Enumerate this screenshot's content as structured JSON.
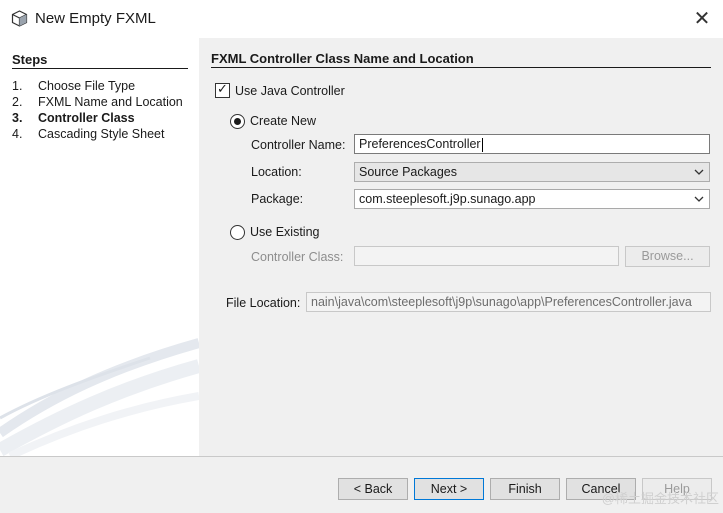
{
  "window": {
    "title": "New Empty FXML",
    "close_symbol": "✕"
  },
  "steps": {
    "title": "Steps",
    "items": [
      {
        "num": "1.",
        "label": "Choose File Type"
      },
      {
        "num": "2.",
        "label": "FXML Name and Location"
      },
      {
        "num": "3.",
        "label": "Controller Class"
      },
      {
        "num": "4.",
        "label": "Cascading Style Sheet"
      }
    ],
    "active_index": 2
  },
  "panel": {
    "title": "FXML Controller Class Name and Location",
    "use_java_controller": {
      "label": "Use Java Controller",
      "checked": true
    },
    "create_new": {
      "label": "Create New",
      "selected": true,
      "controller_name_label": "Controller Name:",
      "controller_name_value": "PreferencesController",
      "location_label": "Location:",
      "location_value": "Source Packages",
      "package_label": "Package:",
      "package_value": "com.steeplesoft.j9p.sunago.app"
    },
    "use_existing": {
      "label": "Use Existing",
      "selected": false,
      "controller_class_label": "Controller Class:",
      "controller_class_value": "",
      "browse_label": "Browse..."
    },
    "file_location": {
      "label": "File Location:",
      "value": "nain\\java\\com\\steeplesoft\\j9p\\sunago\\app\\PreferencesController.java"
    }
  },
  "buttons": {
    "back": "< Back",
    "next": "Next >",
    "finish": "Finish",
    "cancel": "Cancel",
    "help": "Help"
  },
  "watermark": "@稀土掘金技术社区"
}
